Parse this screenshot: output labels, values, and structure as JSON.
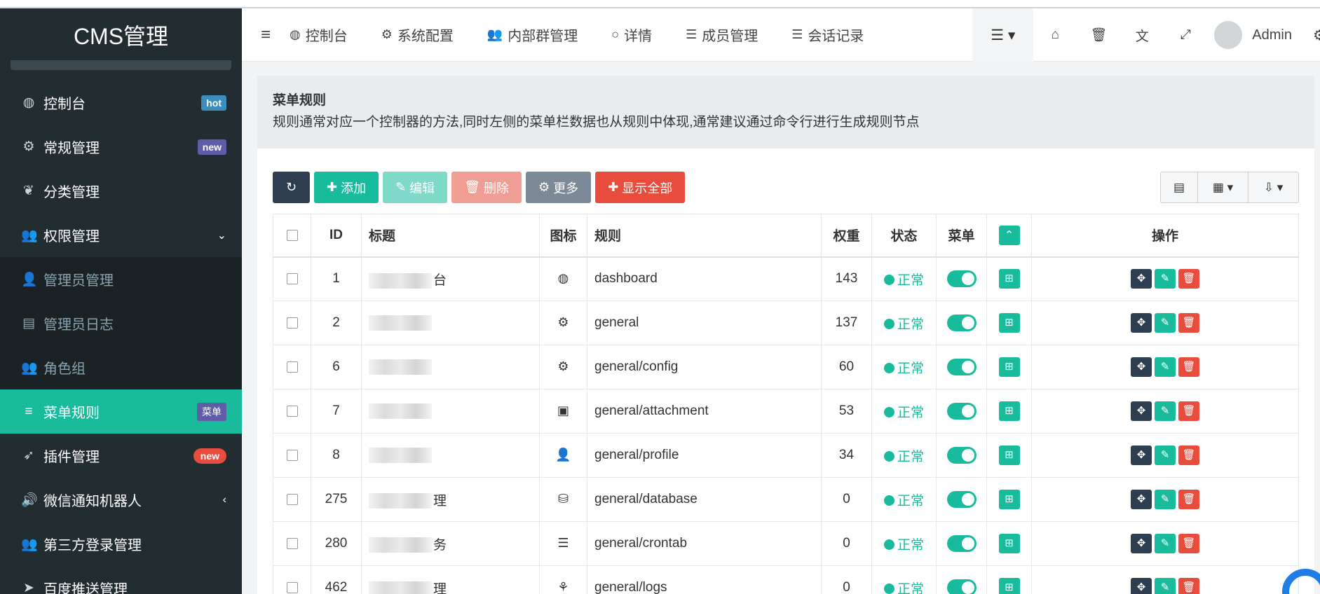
{
  "sidebar": {
    "brand": "CMS管理",
    "items": [
      {
        "label": "控制台",
        "icon": "dashboard-icon",
        "glyph": "◍",
        "badge": "hot",
        "badgeType": "hot",
        "kind": "main"
      },
      {
        "label": "常规管理",
        "icon": "cogs-icon",
        "glyph": "⚙",
        "badge": "new",
        "badgeType": "new",
        "kind": "main"
      },
      {
        "label": "分类管理",
        "icon": "leaf-icon",
        "glyph": "❦",
        "badge": "",
        "badgeType": "",
        "kind": "main"
      },
      {
        "label": "权限管理",
        "icon": "group-icon",
        "glyph": "👥",
        "badge": "",
        "badgeType": "",
        "kind": "main",
        "chev": "⌄"
      },
      {
        "label": "管理员管理",
        "icon": "user-icon",
        "glyph": "👤",
        "badge": "",
        "badgeType": "",
        "kind": "sub"
      },
      {
        "label": "管理员日志",
        "icon": "list-alt-icon",
        "glyph": "▤",
        "badge": "",
        "badgeType": "",
        "kind": "sub"
      },
      {
        "label": "角色组",
        "icon": "group-icon",
        "glyph": "👥",
        "badge": "",
        "badgeType": "",
        "kind": "sub"
      },
      {
        "label": "菜单规则",
        "icon": "bars-icon",
        "glyph": "≡",
        "badge": "菜单",
        "badgeType": "menu",
        "kind": "active"
      },
      {
        "label": "插件管理",
        "icon": "rocket-icon",
        "glyph": "➶",
        "badge": "new",
        "badgeType": "new-red",
        "kind": "main"
      },
      {
        "label": "微信通知机器人",
        "icon": "volume-icon",
        "glyph": "🔊",
        "badge": "",
        "badgeType": "",
        "kind": "main",
        "chev": "‹"
      },
      {
        "label": "第三方登录管理",
        "icon": "group-icon",
        "glyph": "👥",
        "badge": "",
        "badgeType": "",
        "kind": "main"
      },
      {
        "label": "百度推送管理",
        "icon": "paper-plane-icon",
        "glyph": "➤",
        "badge": "",
        "badgeType": "",
        "kind": "main"
      }
    ]
  },
  "header": {
    "tabs": [
      {
        "label": "控制台",
        "icon": "dashboard-icon",
        "glyph": "◍"
      },
      {
        "label": "系统配置",
        "icon": "gear-icon",
        "glyph": "⚙"
      },
      {
        "label": "内部群管理",
        "icon": "group-icon",
        "glyph": "👥"
      },
      {
        "label": "详情",
        "icon": "circle-o-icon",
        "glyph": "○"
      },
      {
        "label": "成员管理",
        "icon": "list-icon",
        "glyph": "☰"
      },
      {
        "label": "会话记录",
        "icon": "list-icon",
        "glyph": "☰"
      }
    ],
    "user": "Admin"
  },
  "panel": {
    "title": "菜单规则",
    "desc": "规则通常对应一个控制器的方法,同时左侧的菜单栏数据也从规则中体现,通常建议通过命令行进行生成规则节点"
  },
  "toolbar": {
    "add": "添加",
    "edit": "编辑",
    "delete": "删除",
    "more": "更多",
    "showAll": "显示全部"
  },
  "table": {
    "headers": {
      "id": "ID",
      "title": "标题",
      "icon": "图标",
      "rule": "规则",
      "weigh": "权重",
      "status": "状态",
      "menu": "菜单",
      "ops": "操作"
    },
    "rows": [
      {
        "id": "1",
        "titleTail": "台",
        "iconName": "dashboard-icon",
        "glyph": "◍",
        "rule": "dashboard",
        "weigh": "143",
        "status": "正常"
      },
      {
        "id": "2",
        "titleTail": "",
        "iconName": "cogs-icon",
        "glyph": "⚙",
        "rule": "general",
        "weigh": "137",
        "status": "正常"
      },
      {
        "id": "6",
        "titleTail": "",
        "iconName": "cog-icon",
        "glyph": "⚙",
        "rule": "general/config",
        "weigh": "60",
        "status": "正常"
      },
      {
        "id": "7",
        "titleTail": "",
        "iconName": "image-icon",
        "glyph": "▣",
        "rule": "general/attachment",
        "weigh": "53",
        "status": "正常"
      },
      {
        "id": "8",
        "titleTail": "",
        "iconName": "user-icon",
        "glyph": "👤",
        "rule": "general/profile",
        "weigh": "34",
        "status": "正常"
      },
      {
        "id": "275",
        "titleTail": "理",
        "iconName": "database-icon",
        "glyph": "⛁",
        "rule": "general/database",
        "weigh": "0",
        "status": "正常"
      },
      {
        "id": "280",
        "titleTail": "务",
        "iconName": "tasks-icon",
        "glyph": "☰",
        "rule": "general/crontab",
        "weigh": "0",
        "status": "正常"
      },
      {
        "id": "462",
        "titleTail": "理",
        "iconName": "pagelines-icon",
        "glyph": "⚘",
        "rule": "general/logs",
        "weigh": "0",
        "status": "正常"
      }
    ]
  },
  "colors": {
    "accent": "#18bc9c",
    "sidebar": "#222d32",
    "danger": "#e74c3c",
    "dark": "#2c3e50"
  }
}
